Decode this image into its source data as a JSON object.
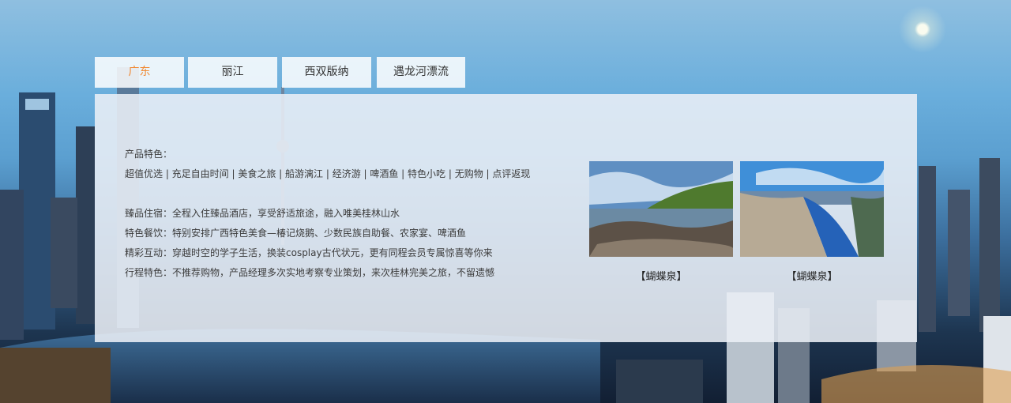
{
  "tabs": [
    {
      "label": "广东",
      "active": true
    },
    {
      "label": "丽江",
      "active": false
    },
    {
      "label": "西双版纳",
      "active": false
    },
    {
      "label": "遇龙河漂流",
      "active": false
    }
  ],
  "panel": {
    "features_title": "产品特色：",
    "features_tags": "超值优选 | 充足自由时间 | 美食之旅 | 船游漓江 | 经济游 | 啤酒鱼 | 特色小吃 | 无购物 | 点评返现",
    "details": [
      "臻品住宿：全程入住臻品酒店，享受舒适旅途，融入唯美桂林山水",
      "特色餐饮：特别安排广西特色美食—椿记烧鹅、少数民族自助餐、农家宴、啤酒鱼",
      "精彩互动：穿越时空的学子生活，换装cosplay古代状元，更有同程会员专属惊喜等你来",
      "行程特色：不推荐购物，产品经理多次实地考察专业策划，来次桂林完美之旅，不留遗憾"
    ],
    "photos": [
      {
        "caption": "【蝴蝶泉】",
        "icon": "coast-rocks-photo"
      },
      {
        "caption": "【蝴蝶泉】",
        "icon": "fjord-photo"
      }
    ]
  },
  "colors": {
    "active_tab": "#f08a35",
    "tab_bg": "#ffffff",
    "panel_bg": "#eaeff6"
  }
}
